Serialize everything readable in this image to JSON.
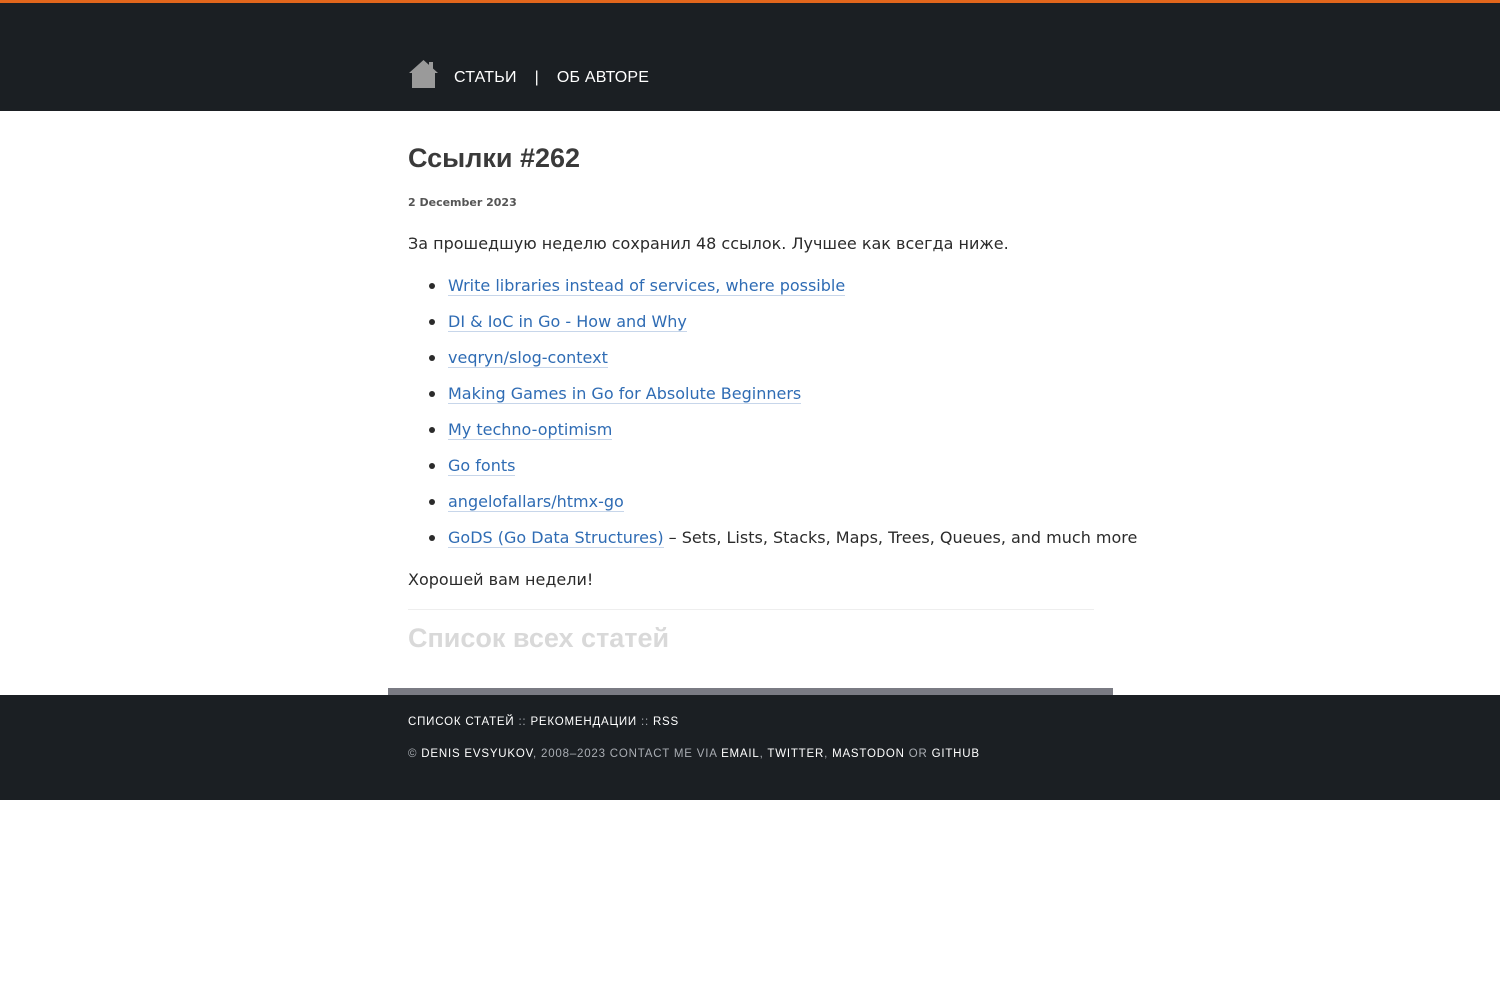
{
  "header": {
    "accent_color": "#e2661c",
    "background": "#1b1f23",
    "home_icon": "home-icon",
    "nav": {
      "articles": "СТАТЬИ",
      "separator": "|",
      "about": "ОБ АВТОРЕ"
    }
  },
  "post": {
    "title": "Ссылки #262",
    "date": "2 December 2023",
    "intro": "За прошедшую неделю сохранил 48 ссылок. Лучшее как всегда ниже.",
    "links": [
      {
        "text": "Write libraries instead of services, where possible",
        "suffix": ""
      },
      {
        "text": "DI & IoC in Go - How and Why",
        "suffix": ""
      },
      {
        "text": "veqryn/slog-context",
        "suffix": ""
      },
      {
        "text": "Making Games in Go for Absolute Beginners",
        "suffix": ""
      },
      {
        "text": "My techno-optimism",
        "suffix": ""
      },
      {
        "text": "Go fonts",
        "suffix": ""
      },
      {
        "text": "angelofallars/htmx-go",
        "suffix": ""
      },
      {
        "text": "GoDS (Go Data Structures)",
        "suffix": " – Sets, Lists, Stacks, Maps, Trees, Queues, and much more"
      }
    ],
    "outro": "Хорошей вам недели!",
    "all_articles": "Список всех статей"
  },
  "footer": {
    "row1": {
      "list": "СПИСОК СТАТЕЙ",
      "sep": "::",
      "recommendations": "РЕКОМЕНДАЦИИ",
      "rss": "RSS"
    },
    "row2": {
      "copyright": "©",
      "author": "DENIS EVSYUKOV",
      "years_contact": ", 2008–2023 CONTACT ME VIA",
      "email": "EMAIL",
      "comma": ",",
      "twitter": "TWITTER",
      "mastodon": "MASTODON",
      "or": "OR",
      "github": "GITHUB"
    }
  }
}
